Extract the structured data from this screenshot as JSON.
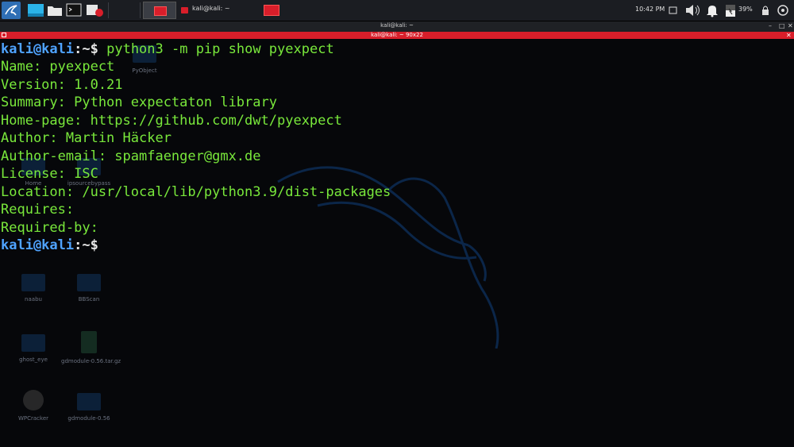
{
  "taskbar": {
    "task_terminal_label": "kali@kali: ~",
    "clock": "10:42 PM",
    "battery_pct": "39%"
  },
  "terminal": {
    "window_title": "kali@kali: ~",
    "tab_title": "kali@kali: ~ 90x22",
    "prompt": {
      "user_host": "kali@kali",
      "sep": ":",
      "path": "~",
      "symbol": "$"
    },
    "command": " python3 -m pip show pyexpect",
    "output": [
      "Name: pyexpect",
      "Version: 1.0.21",
      "Summary: Python expectaton library",
      "Home-page: https://github.com/dwt/pyexpect",
      "Author: Martin Häcker",
      "Author-email: spamfaenger@gmx.de",
      "License: ISC",
      "Location: /usr/local/lib/python3.9/dist-packages",
      "Requires:",
      "Required-by:"
    ]
  },
  "desktop_icons": [
    {
      "name": "PyObject"
    },
    {
      "name": "Home"
    },
    {
      "name": "ipsourcebypass"
    },
    {
      "name": "naabu"
    },
    {
      "name": "BBScan"
    },
    {
      "name": "ghost_eye"
    },
    {
      "name": "gdmodule-0.56.tar.gz"
    },
    {
      "name": "WPCracker"
    },
    {
      "name": "gdmodule-0.56"
    }
  ],
  "colors": {
    "panel": "#1b1d22",
    "accent_red": "#d81e2a",
    "term_bg": "#06070a",
    "output_green": "#79e83b",
    "prompt_blue": "#4fa3ff"
  }
}
